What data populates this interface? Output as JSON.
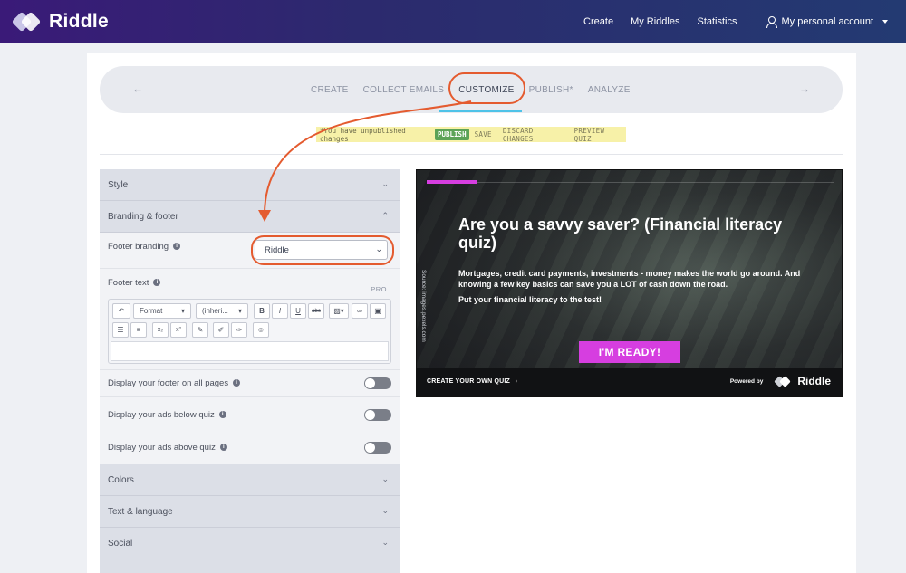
{
  "topbar": {
    "brand": "Riddle",
    "nav": [
      "Create",
      "My Riddles",
      "Statistics"
    ],
    "account_label": "My personal account"
  },
  "steps": {
    "items": [
      "CREATE",
      "COLLECT EMAILS",
      "CUSTOMIZE",
      "PUBLISH*",
      "ANALYZE"
    ],
    "active": "CUSTOMIZE",
    "prev_arrow": "←",
    "next_arrow": "→"
  },
  "unpublished": {
    "message": "*You have unpublished changes",
    "publish": "PUBLISH",
    "save": "SAVE",
    "discard": "DISCARD CHANGES",
    "preview": "PREVIEW QUIZ"
  },
  "panel": {
    "style": "Style",
    "branding": "Branding & footer",
    "footer_branding_label": "Footer branding",
    "footer_branding_value": "Riddle",
    "footer_text_label": "Footer text",
    "pro": "PRO",
    "toolbar": {
      "format": "Format",
      "font": "(inheri...",
      "bold": "B",
      "italic": "I",
      "underline": "U",
      "strike": "abc"
    },
    "display_footer": "Display your footer on all pages",
    "ads_below": "Display your ads below quiz",
    "ads_above": "Display your ads above quiz",
    "colors": "Colors",
    "text_language": "Text & language",
    "social": "Social"
  },
  "preview": {
    "title": "Are you a savvy saver? (Financial literacy quiz)",
    "desc": "Mortgages, credit card payments, investments - money makes the world go around. And knowing a few key basics can save you a LOT of cash down the road.",
    "desc2": "Put your financial literacy to the test!",
    "source": "Source: images.pexels.com",
    "button": "I'M READY!",
    "cta": "CREATE YOUR OWN QUIZ",
    "powered": "Powered by",
    "powered_brand": "Riddle"
  },
  "colors": {
    "accent": "#d63ee0",
    "highlight": "#e45b2f",
    "publish_green": "#5ca357",
    "topbar_start": "#3a1a78"
  }
}
